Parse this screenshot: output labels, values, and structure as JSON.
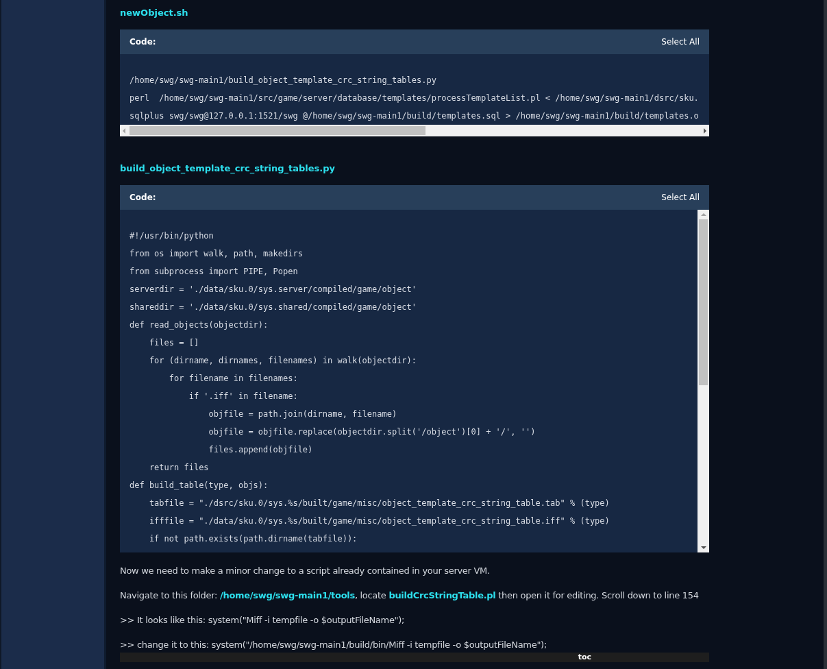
{
  "sections": [
    {
      "title": "newObject.sh",
      "code": {
        "label": "Code:",
        "action": "Select All",
        "kind": "scroll-x",
        "lines": [
          "/home/swg/swg-main1/build_object_template_crc_string_tables.py",
          "perl  /home/swg/swg-main1/src/game/server/database/templates/processTemplateList.pl < /home/swg/swg-main1/dsrc/sku.",
          "sqlplus swg/swg@127.0.0.1:1521/swg @/home/swg/swg-main1/build/templates.sql > /home/swg/swg-main1/build/templates.o"
        ]
      }
    },
    {
      "title": "build_object_template_crc_string_tables.py",
      "code": {
        "label": "Code:",
        "action": "Select All",
        "kind": "scroll-y",
        "lines": [
          "#!/usr/bin/python",
          "from os import walk, path, makedirs",
          "from subprocess import PIPE, Popen",
          "serverdir = './data/sku.0/sys.server/compiled/game/object'",
          "shareddir = './data/sku.0/sys.shared/compiled/game/object'",
          "def read_objects(objectdir):",
          "    files = []",
          "    for (dirname, dirnames, filenames) in walk(objectdir):",
          "        for filename in filenames:",
          "            if '.iff' in filename:",
          "                objfile = path.join(dirname, filename)",
          "                objfile = objfile.replace(objectdir.split('/object')[0] + '/', '')",
          "                files.append(objfile)",
          "    return files",
          "def build_table(type, objs):",
          "    tabfile = \"./dsrc/sku.0/sys.%s/built/game/misc/object_template_crc_string_table.tab\" % (type)",
          "    ifffile = \"./data/sku.0/sys.%s/built/game/misc/object_template_crc_string_table.iff\" % (type)",
          "    if not path.exists(path.dirname(tabfile)):"
        ]
      }
    }
  ],
  "paragraphs": [
    [
      {
        "kind": "text",
        "text": "Now we need to make a minor change to a script already contained in your server VM."
      }
    ],
    [
      {
        "kind": "text",
        "text": "Navigate to this folder: "
      },
      {
        "kind": "link",
        "text": "/home/swg/swg-main1/tools"
      },
      {
        "kind": "text",
        "text": ", locate "
      },
      {
        "kind": "link",
        "text": "buildCrcStringTable.pl"
      },
      {
        "kind": "text",
        "text": " then open it for editing. Scroll down to line 154"
      }
    ],
    [
      {
        "kind": "text",
        "text": ">> It looks like this: system(\"Miff -i tempfile -o $outputFileName\");"
      }
    ],
    [
      {
        "kind": "text",
        "text": ">> change it to this: system(\"/home/swg/swg-main1/build/bin/Miff -i tempfile -o $outputFileName\");"
      }
    ]
  ],
  "footer_bar": {
    "text": "toc"
  }
}
